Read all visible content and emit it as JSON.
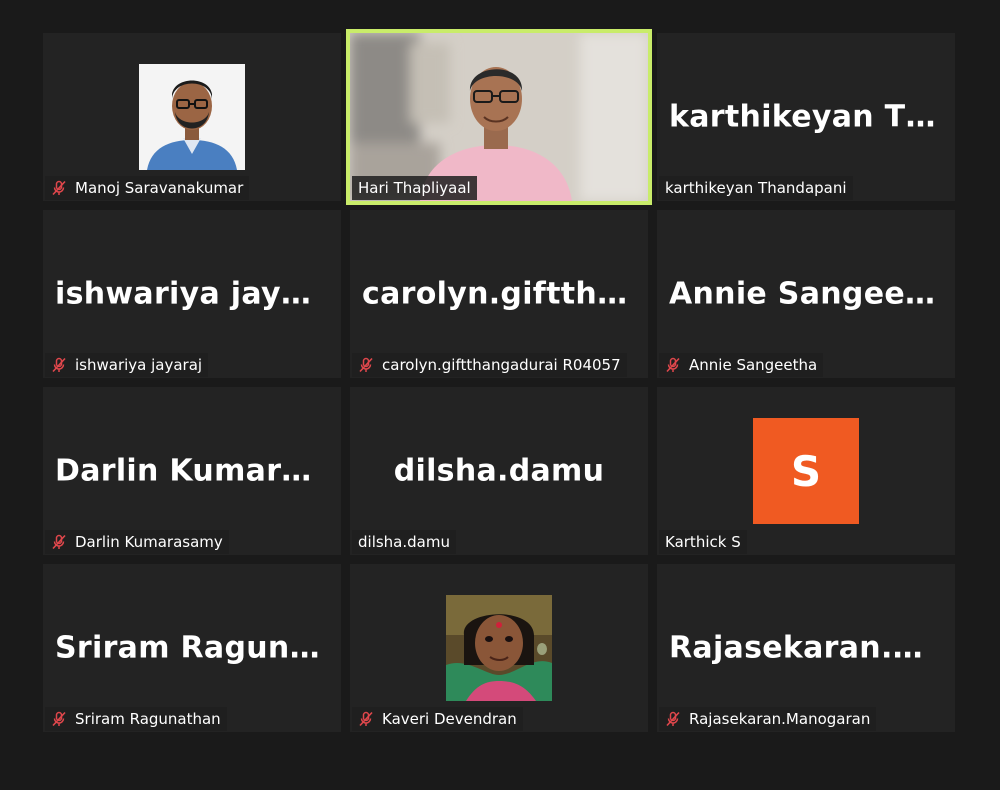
{
  "participants": [
    {
      "name": "Manoj Saravanakumar",
      "display": "",
      "muted": true,
      "type": "photo-man"
    },
    {
      "name": "Hari Thapliyaal",
      "display": "",
      "muted": false,
      "type": "video",
      "active": true
    },
    {
      "name": "karthikeyan Thandapani",
      "display": "karthikeyan Tha...",
      "muted": false,
      "type": "text"
    },
    {
      "name": "ishwariya jayaraj",
      "display": "ishwariya jayaraj",
      "muted": true,
      "type": "text"
    },
    {
      "name": "carolyn.giftthangadurai R04057",
      "display": "carolyn.giftthan...",
      "muted": true,
      "type": "text"
    },
    {
      "name": "Annie Sangeetha",
      "display": "Annie Sangeetha",
      "muted": true,
      "type": "text"
    },
    {
      "name": "Darlin Kumarasamy",
      "display": "Darlin Kumaras...",
      "muted": true,
      "type": "text"
    },
    {
      "name": "dilsha.damu",
      "display": "dilsha.damu",
      "muted": false,
      "type": "text"
    },
    {
      "name": "Karthick S",
      "display": "",
      "initial": "S",
      "muted": false,
      "type": "initial"
    },
    {
      "name": "Sriram Ragunathan",
      "display": "Sriram Ragunat...",
      "muted": true,
      "type": "text"
    },
    {
      "name": "Kaveri Devendran",
      "display": "",
      "muted": true,
      "type": "photo-woman"
    },
    {
      "name": "Rajasekaran.Manogaran",
      "display": "Rajasekaran.Ma...",
      "muted": true,
      "type": "text"
    }
  ],
  "colors": {
    "active_border": "#c9ec6a",
    "muted_icon": "#e0474c",
    "initial_bg": "#f05a22"
  },
  "icons": {
    "muted": "mic-muted-icon"
  }
}
